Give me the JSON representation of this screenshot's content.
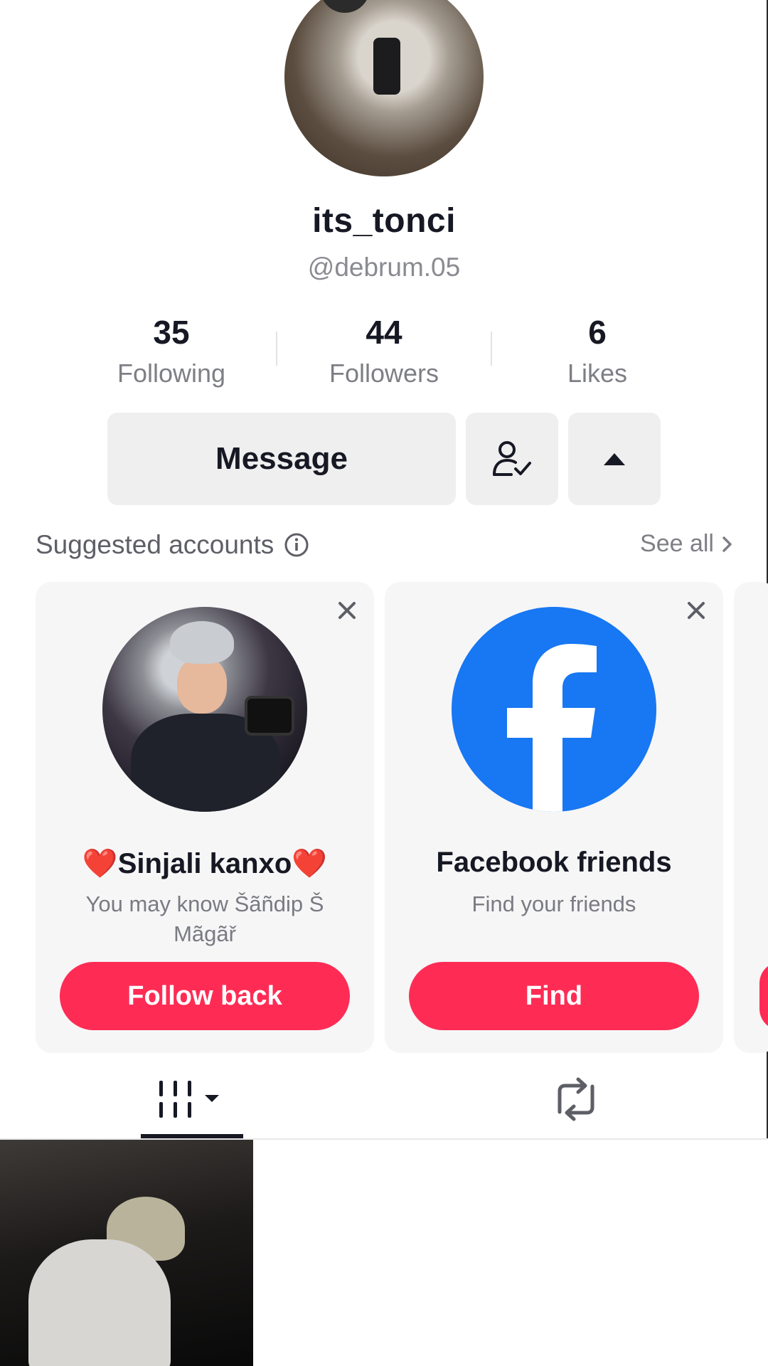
{
  "profile": {
    "display_name": "its_tonci",
    "handle": "@debrum.05"
  },
  "stats": {
    "following_count": "35",
    "following_label": "Following",
    "followers_count": "44",
    "followers_label": "Followers",
    "likes_count": "6",
    "likes_label": "Likes"
  },
  "actions": {
    "message_label": "Message"
  },
  "suggested": {
    "title": "Suggested accounts",
    "see_all": "See all",
    "cards": [
      {
        "name": "❤️Sinjali kanxo❤️",
        "subtitle": "You may know Šãñdip Š Mãgãř",
        "button": "Follow back"
      },
      {
        "name": "Facebook friends",
        "subtitle": "Find your friends",
        "button": "Find"
      }
    ]
  },
  "colors": {
    "accent": "#fe2c55",
    "facebook": "#1877f2"
  },
  "icons": {
    "friend_status": "person-check-icon",
    "more": "caret-up-icon",
    "info": "info-icon",
    "see_all": "chevron-right-icon",
    "close": "close-icon",
    "videos_tab": "grid-bars-icon",
    "reposts_tab": "repost-icon"
  }
}
